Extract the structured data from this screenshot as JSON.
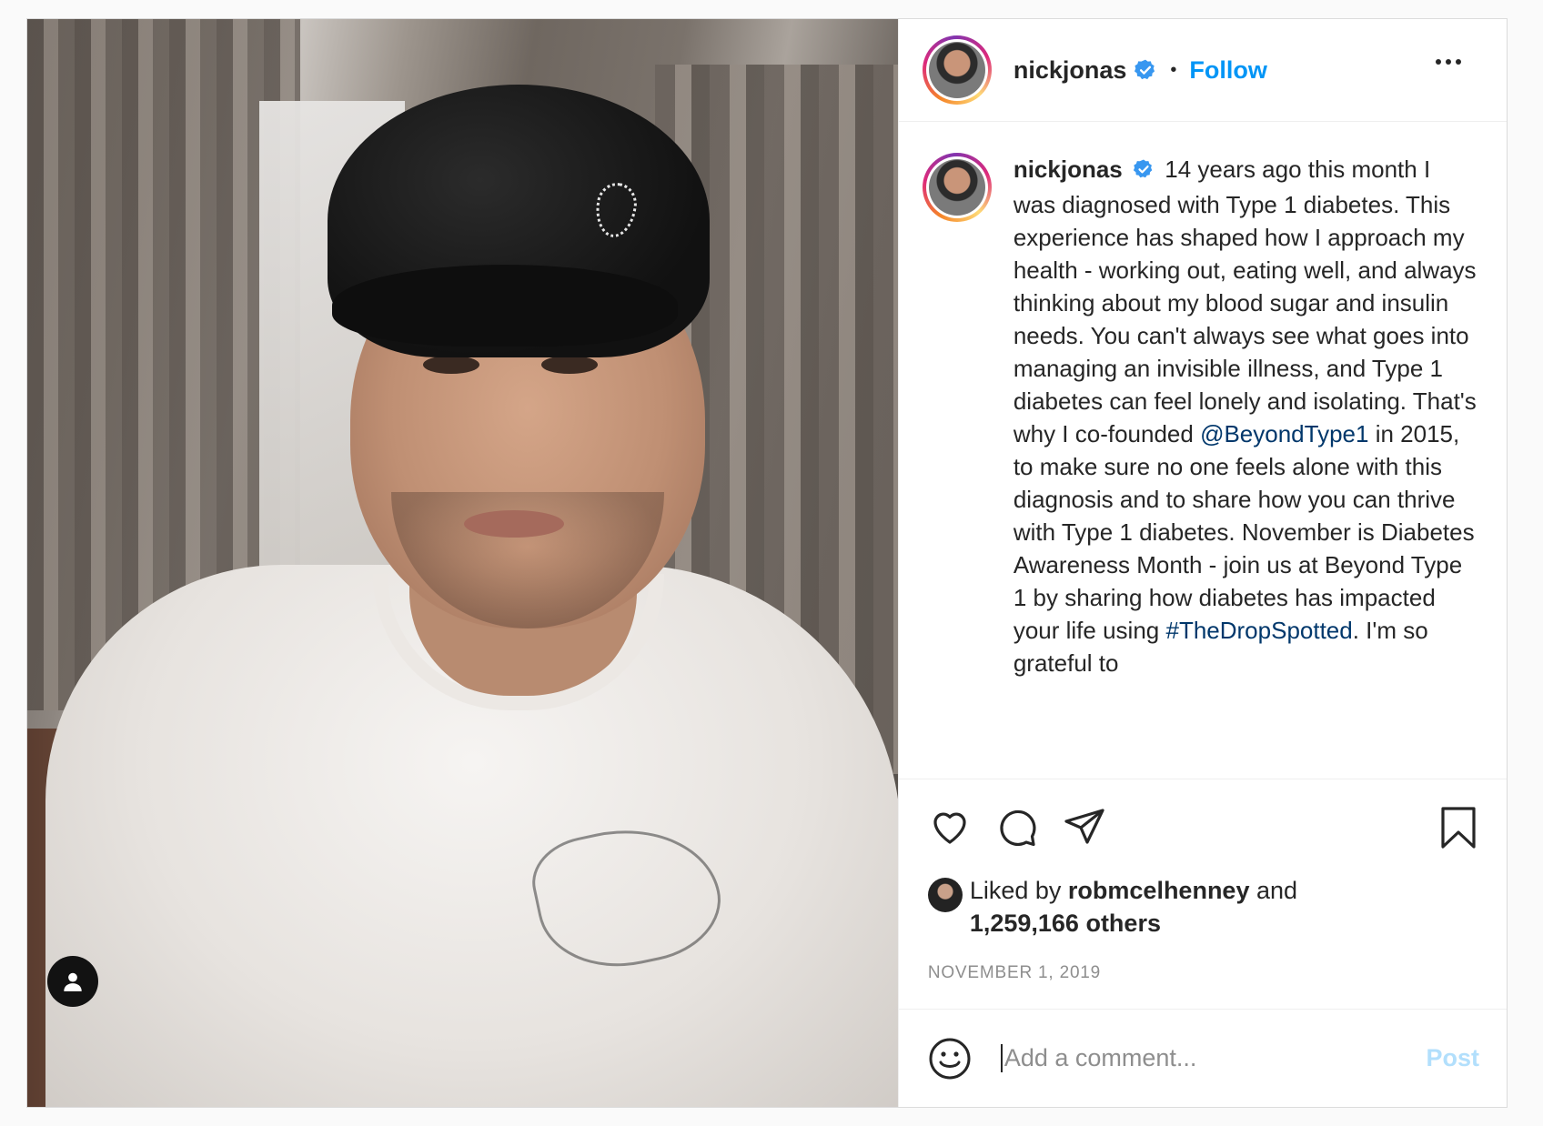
{
  "header": {
    "username": "nickjonas",
    "separator": "•",
    "follow_label": "Follow"
  },
  "caption": {
    "username": "nickjonas",
    "text_part1": "14 years ago this month I was diagnosed with Type 1 diabetes. This experience has shaped how I approach my health - working out, eating well, and always thinking about my blood sugar and insulin needs. You can't always see what goes into managing an invisible illness, and Type 1 diabetes can feel lonely and isolating. That's why I co-founded ",
    "mention": "@BeyondType1",
    "text_part2": " in 2015, to make sure no one feels alone with this diagnosis and to share how you can thrive with Type 1 diabetes. November is Diabetes Awareness Month - join us at Beyond Type 1 by sharing how diabetes has impacted your life using ",
    "hashtag": "#TheDropSpotted",
    "text_part3": ". I'm so grateful to"
  },
  "likes": {
    "prefix": "Liked by ",
    "liker": "robmcelhenney",
    "conjunction": " and",
    "others": "1,259,166 others"
  },
  "date": "NOVEMBER 1, 2019",
  "comment": {
    "placeholder": "Add a comment...",
    "post_label": "Post"
  },
  "icons": {
    "verified": "verified-badge-icon",
    "more": "more-options-icon",
    "like": "heart-icon",
    "comment": "comment-bubble-icon",
    "share": "paper-plane-icon",
    "save": "bookmark-icon",
    "emoji": "emoji-smile-icon",
    "user_tag": "user-tag-icon"
  },
  "colors": {
    "follow": "#0095f6",
    "verified": "#3897f0",
    "link": "#00376b",
    "post_disabled": "#b2dffc",
    "muted": "#8e8e8e"
  }
}
